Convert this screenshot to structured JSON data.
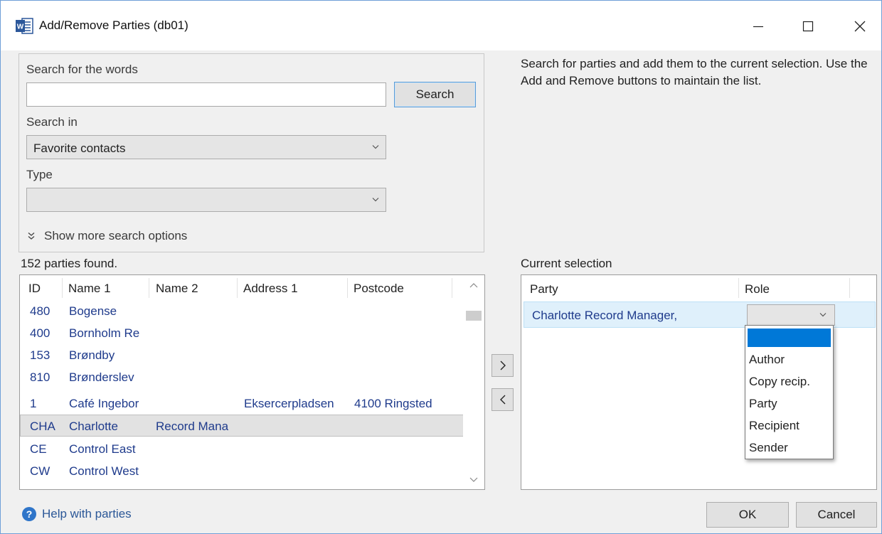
{
  "window": {
    "title": "Add/Remove Parties (db01)",
    "icon": "word-icon",
    "controls": [
      "minimize-icon",
      "maximize-icon",
      "close-icon"
    ]
  },
  "search": {
    "words_label": "Search for the words",
    "words_value": "",
    "search_button": "Search",
    "search_in_label": "Search in",
    "search_in_value": "Favorite contacts",
    "type_label": "Type",
    "type_value": "",
    "more_options": "Show more search options"
  },
  "description": "Search for parties and add them to the current selection. Use the Add and Remove buttons to maintain the list.",
  "results": {
    "count_text": "152 parties found.",
    "columns": [
      "ID",
      "Name 1",
      "Name 2",
      "Address 1",
      "Postcode"
    ],
    "rows": [
      {
        "id": "480",
        "name1": "Bogense",
        "name2": "",
        "address1": "",
        "postcode": ""
      },
      {
        "id": "400",
        "name1": "Bornholm Re",
        "name2": "",
        "address1": "",
        "postcode": ""
      },
      {
        "id": "153",
        "name1": "Brøndby",
        "name2": "",
        "address1": "",
        "postcode": ""
      },
      {
        "id": "810",
        "name1": "Brønderslev",
        "name2": "",
        "address1": "",
        "postcode": ""
      },
      {
        "id": "1",
        "name1": "Café Ingebor",
        "name2": "",
        "address1": "Eksercerpladsen",
        "postcode": "4100 Ringsted"
      },
      {
        "id": "CHA",
        "name1": "Charlotte",
        "name2": "Record Mana",
        "address1": "",
        "postcode": ""
      },
      {
        "id": "CE",
        "name1": "Control East",
        "name2": "",
        "address1": "",
        "postcode": ""
      },
      {
        "id": "CW",
        "name1": "Control West",
        "name2": "",
        "address1": "",
        "postcode": ""
      }
    ],
    "selected_row": "CHA"
  },
  "move_buttons": {
    "add": ">",
    "remove": "<"
  },
  "selection": {
    "label": "Current selection",
    "columns": [
      "Party",
      "Role"
    ],
    "rows": [
      {
        "party": "Charlotte Record Manager,",
        "role": ""
      }
    ],
    "role_options": [
      "",
      "Author",
      "Copy recip.",
      "Party",
      "Recipient",
      "Sender"
    ]
  },
  "footer": {
    "help_text": "Help with parties",
    "ok": "OK",
    "cancel": "Cancel"
  },
  "colors": {
    "accent": "#0078d7",
    "link_text": "#1f3b8c",
    "selection_bg": "#dff0fb",
    "window_bg": "#f0f0f0"
  }
}
